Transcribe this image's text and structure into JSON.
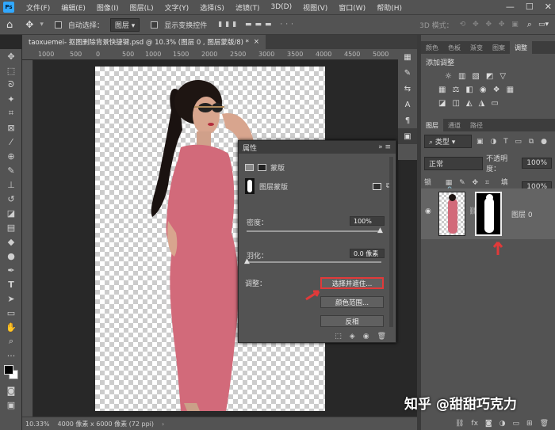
{
  "menubar": {
    "items": [
      "文件(F)",
      "编辑(E)",
      "图像(I)",
      "图层(L)",
      "文字(Y)",
      "选择(S)",
      "滤镜(T)",
      "3D(D)",
      "视图(V)",
      "窗口(W)",
      "帮助(H)"
    ]
  },
  "options": {
    "auto_select": "自动选择：",
    "auto_select_value": "图层",
    "show_transform": "显示变换控件",
    "mode3d": "3D 模式："
  },
  "doc_tab": {
    "title": "taoxuemei- 抠图删除背景快捷键.psd @ 10.3% (图层 0 , 图层蒙版/8) *"
  },
  "ruler": {
    "labels": [
      "1000",
      "500",
      "0",
      "500",
      "1000",
      "1500",
      "2000",
      "2500",
      "3000",
      "3500",
      "4000",
      "4500",
      "5000"
    ]
  },
  "status": {
    "zoom": "10.33%",
    "docsize": "4000 像素 x 6000 像素 (72 ppi)"
  },
  "properties": {
    "title": "属性",
    "section": "蒙版",
    "mask_label": "图层蒙版",
    "density_label": "密度：",
    "density_value": "100%",
    "feather_label": "羽化：",
    "feather_value": "0.0 像素",
    "refine_label": "调整：",
    "btn_select_mask": "选择并遮住...",
    "btn_color_range": "颜色范围...",
    "btn_invert": "反相"
  },
  "panels_top": {
    "tabs": [
      "颜色",
      "色板",
      "渐变",
      "图案",
      "调整"
    ],
    "add_adjustment": "添加调整"
  },
  "layers": {
    "tabs": [
      "图层",
      "通道",
      "路径"
    ],
    "filter_kind": "类型",
    "blend_mode": "正常",
    "opacity_label": "不透明度：",
    "opacity_value": "100%",
    "lock_label": "锁定：",
    "fill_label": "填充：",
    "fill_value": "100%",
    "layer_name": "图层 0"
  },
  "watermark": "知乎 @甜甜巧克力",
  "colors": {
    "accent": "#e03a3a"
  }
}
